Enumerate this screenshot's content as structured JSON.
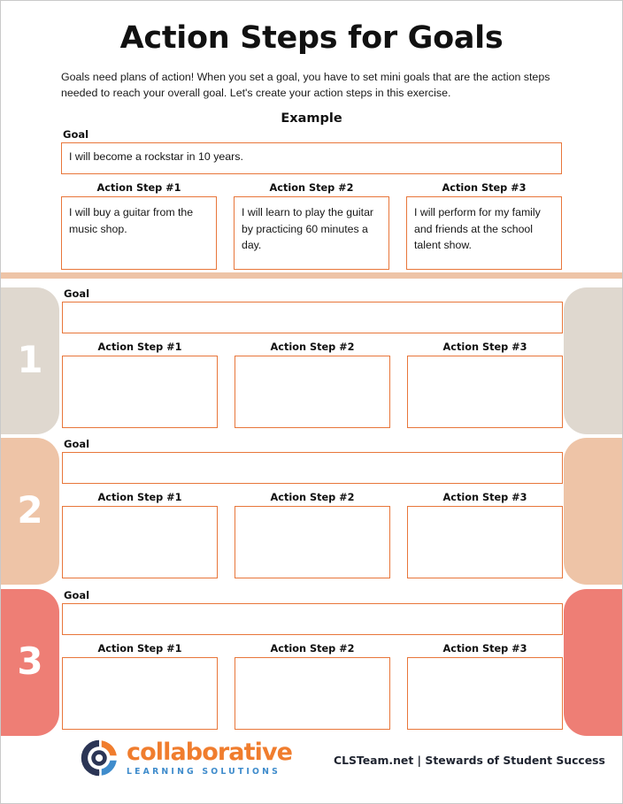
{
  "header": {
    "title": "Action Steps for Goals",
    "intro": "Goals need plans of action! When you set a goal, you have to set mini goals that are the action steps needed to reach your overall goal. Let's create your action steps in this exercise.",
    "example_heading": "Example"
  },
  "labels": {
    "goal": "Goal",
    "step1": "Action Step #1",
    "step2": "Action Step #2",
    "step3": "Action Step #3"
  },
  "example": {
    "goal_value": "I will become a rockstar in 10 years.",
    "steps": [
      "I will buy a guitar from the music shop.",
      "I will learn to play the guitar by practicing 60 minutes a day.",
      "I will perform for my family and friends at the school talent show."
    ]
  },
  "sections": [
    {
      "number": "1",
      "color": "#dfd8cf",
      "goal_value": "",
      "steps": [
        "",
        "",
        ""
      ]
    },
    {
      "number": "2",
      "color": "#eec4a7",
      "goal_value": "",
      "steps": [
        "",
        "",
        ""
      ]
    },
    {
      "number": "3",
      "color": "#ee7e75",
      "goal_value": "",
      "steps": [
        "",
        "",
        ""
      ]
    }
  ],
  "footer": {
    "logo_word": "collaborative",
    "logo_sub": "LEARNING SOLUTIONS",
    "tagline": "CLSTeam.net | Stewards of Student Success",
    "logo_navy": "#2b3555",
    "logo_orange": "#f07d2e",
    "logo_blue": "#3f8ccc"
  },
  "theme": {
    "box_border": "#e8763a",
    "divider": "#eec4a7"
  }
}
